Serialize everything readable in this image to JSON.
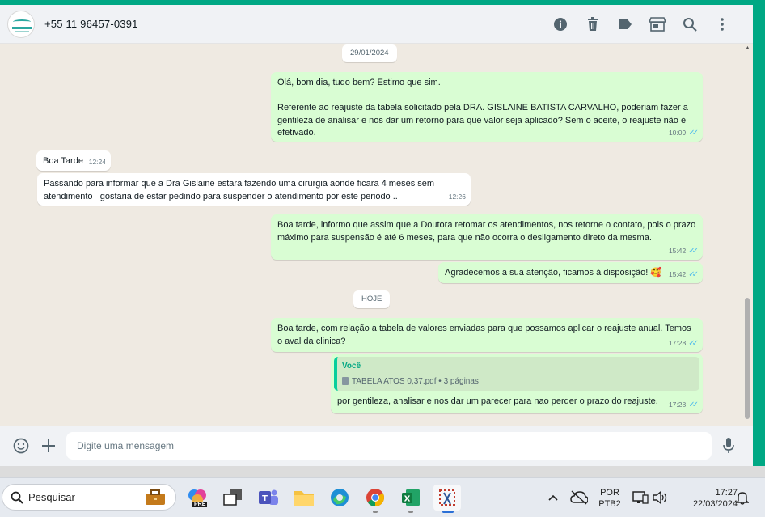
{
  "header": {
    "contact_name": "+55 11 96457-0391",
    "icons": [
      "info-icon",
      "trash-icon",
      "label-icon",
      "store-icon",
      "search-icon",
      "menu-icon"
    ]
  },
  "chat": {
    "dates": [
      "29/01/2024",
      "HOJE"
    ],
    "messages": [
      {
        "dir": "out",
        "text": "Olá, bom dia, tudo bem? Estimo que sim.\n\nReferente ao reajuste da tabela solicitado pela DRA. GISLAINE BATISTA CARVALHO, poderiam fazer a gentileza de analisar e nos dar um retorno para que valor seja aplicado? Sem o aceite, o reajuste não é efetivado.",
        "time": "10:09"
      },
      {
        "dir": "in",
        "text": "Boa Tarde",
        "time": "12:24"
      },
      {
        "dir": "in",
        "text": "Passando para informar que a Dra Gislaine estara fazendo uma cirurgia aonde ficara 4 meses sem atendimento   gostaria de estar pedindo para suspender o atendimento por este periodo ..",
        "time": "12:26"
      },
      {
        "dir": "out",
        "text": "Boa tarde, informo que assim que a Doutora retomar os atendimentos, nos retorne o contato, pois o prazo máximo para suspensão é até 6 meses, para que não ocorra o desligamento direto da mesma.",
        "time": "15:42"
      },
      {
        "dir": "out",
        "text": "Agradecemos a sua atenção, ficamos à disposição! 🥰",
        "time": "15:42"
      },
      {
        "dir": "out",
        "text": "Boa tarde, com relação a tabela de valores enviadas para que possamos aplicar o reajuste anual. Temos o aval da clinica?",
        "time": "17:28"
      },
      {
        "dir": "out",
        "quote_name": "Você",
        "quote_file": "TABELA ATOS 0,37.pdf • 3 páginas",
        "text": "por gentileza, analisar e nos dar um parecer para nao perder o prazo do reajuste.",
        "time": "17:28"
      }
    ]
  },
  "composer": {
    "placeholder": "Digite uma mensagem"
  },
  "taskbar": {
    "search_label": "Pesquisar",
    "lang_top": "POR",
    "lang_bottom": "PTB2",
    "time": "17:27",
    "date": "22/03/2024",
    "pre_badge": "PRE"
  },
  "colors": {
    "accent": "#00a884",
    "outgoing_bubble": "#d9fdd3",
    "incoming_bubble": "#ffffff",
    "chat_background": "#efeae2",
    "read_ticks": "#53bdeb"
  }
}
